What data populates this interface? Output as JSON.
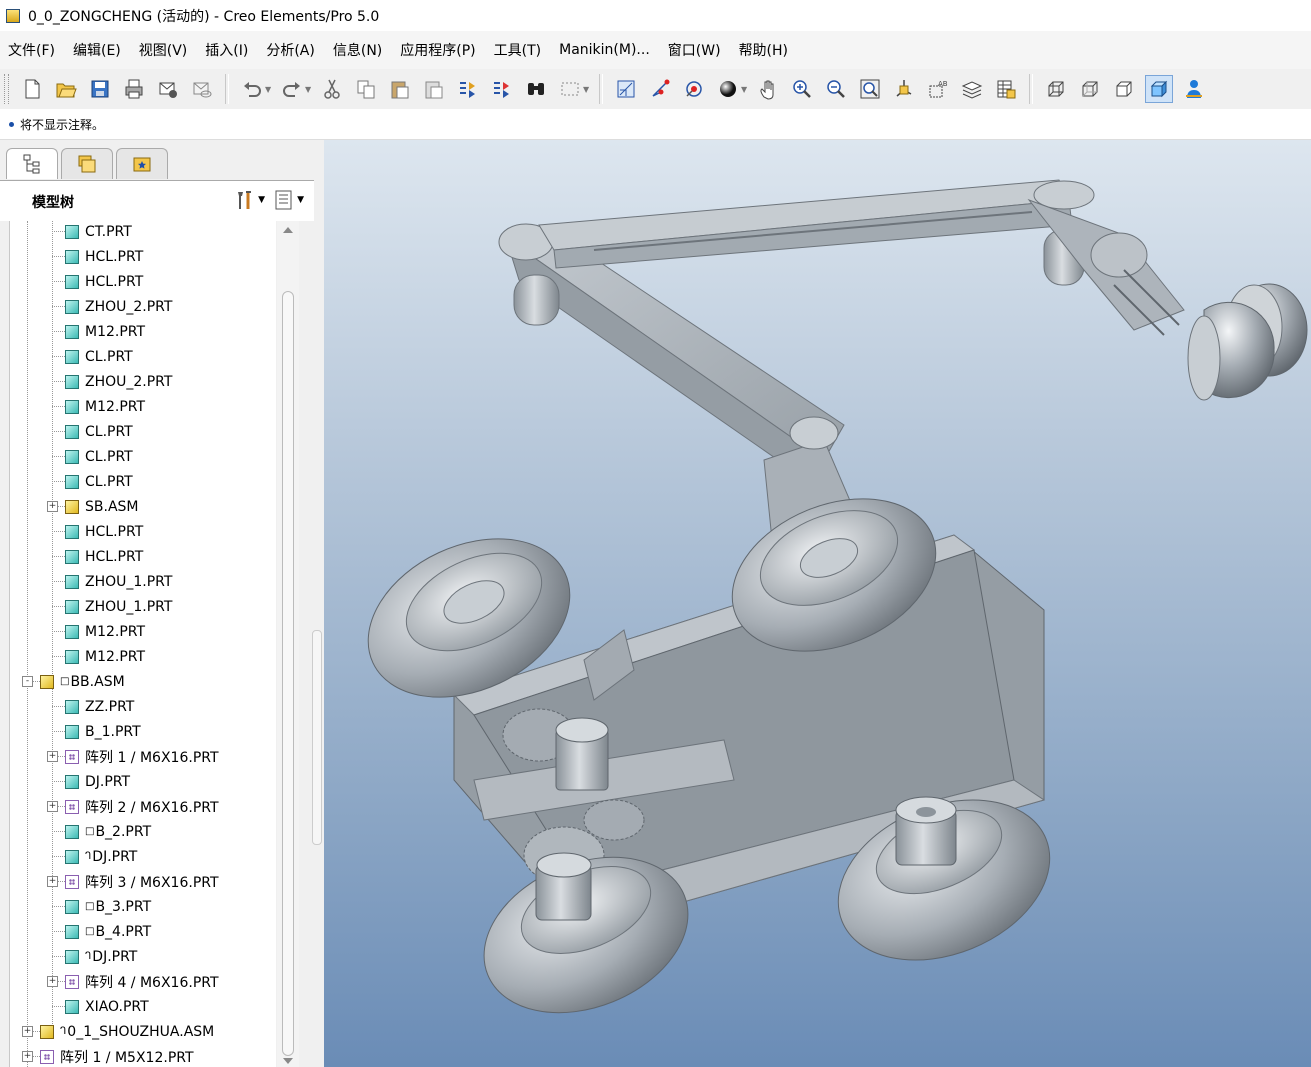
{
  "window": {
    "title": "0_0_ZONGCHENG (活动的) - Creo Elements/Pro 5.0"
  },
  "menu": [
    {
      "id": "file",
      "label": "文件(F)"
    },
    {
      "id": "edit",
      "label": "编辑(E)"
    },
    {
      "id": "view",
      "label": "视图(V)"
    },
    {
      "id": "insert",
      "label": "插入(I)"
    },
    {
      "id": "analysis",
      "label": "分析(A)"
    },
    {
      "id": "info",
      "label": "信息(N)"
    },
    {
      "id": "applications",
      "label": "应用程序(P)"
    },
    {
      "id": "tools",
      "label": "工具(T)"
    },
    {
      "id": "manikin",
      "label": "Manikin(M)..."
    },
    {
      "id": "window",
      "label": "窗口(W)"
    },
    {
      "id": "help",
      "label": "帮助(H)"
    }
  ],
  "message": {
    "text": "将不显示注释。"
  },
  "left_panel": {
    "tabs": [
      {
        "id": "model-tree",
        "icon": "model-tree-icon"
      },
      {
        "id": "folder-browser",
        "icon": "folder-browser-icon"
      },
      {
        "id": "favorites",
        "icon": "favorites-icon"
      }
    ],
    "tree_title": "模型树"
  },
  "tree_rows": [
    {
      "label": "CT.PRT",
      "icon": "prt",
      "level": 2,
      "exp": "",
      "prefix": ""
    },
    {
      "label": "HCL.PRT",
      "icon": "prt",
      "level": 2,
      "exp": "",
      "prefix": ""
    },
    {
      "label": "HCL.PRT",
      "icon": "prt",
      "level": 2,
      "exp": "",
      "prefix": ""
    },
    {
      "label": "ZHOU_2.PRT",
      "icon": "prt",
      "level": 2,
      "exp": "",
      "prefix": ""
    },
    {
      "label": "M12.PRT",
      "icon": "prt",
      "level": 2,
      "exp": "",
      "prefix": ""
    },
    {
      "label": "CL.PRT",
      "icon": "prt",
      "level": 2,
      "exp": "",
      "prefix": ""
    },
    {
      "label": "ZHOU_2.PRT",
      "icon": "prt",
      "level": 2,
      "exp": "",
      "prefix": ""
    },
    {
      "label": "M12.PRT",
      "icon": "prt",
      "level": 2,
      "exp": "",
      "prefix": ""
    },
    {
      "label": "CL.PRT",
      "icon": "prt",
      "level": 2,
      "exp": "",
      "prefix": ""
    },
    {
      "label": "CL.PRT",
      "icon": "prt",
      "level": 2,
      "exp": "",
      "prefix": ""
    },
    {
      "label": "CL.PRT",
      "icon": "prt",
      "level": 2,
      "exp": "",
      "prefix": ""
    },
    {
      "label": "SB.ASM",
      "icon": "asm",
      "level": 2,
      "exp": "+",
      "prefix": ""
    },
    {
      "label": "HCL.PRT",
      "icon": "prt",
      "level": 2,
      "exp": "",
      "prefix": ""
    },
    {
      "label": "HCL.PRT",
      "icon": "prt",
      "level": 2,
      "exp": "",
      "prefix": ""
    },
    {
      "label": "ZHOU_1.PRT",
      "icon": "prt",
      "level": 2,
      "exp": "",
      "prefix": ""
    },
    {
      "label": "ZHOU_1.PRT",
      "icon": "prt",
      "level": 2,
      "exp": "",
      "prefix": ""
    },
    {
      "label": "M12.PRT",
      "icon": "prt",
      "level": 2,
      "exp": "",
      "prefix": ""
    },
    {
      "label": "M12.PRT",
      "icon": "prt",
      "level": 2,
      "exp": "",
      "prefix": ""
    },
    {
      "label": "BB.ASM",
      "icon": "asm",
      "level": 1,
      "exp": "-",
      "prefix": "□"
    },
    {
      "label": "ZZ.PRT",
      "icon": "prt",
      "level": 2,
      "exp": "",
      "prefix": ""
    },
    {
      "label": "B_1.PRT",
      "icon": "prt",
      "level": 2,
      "exp": "",
      "prefix": ""
    },
    {
      "label": "阵列 1 / M6X16.PRT",
      "icon": "pat",
      "level": 2,
      "exp": "+",
      "prefix": ""
    },
    {
      "label": "DJ.PRT",
      "icon": "prt",
      "level": 2,
      "exp": "",
      "prefix": ""
    },
    {
      "label": "阵列 2 / M6X16.PRT",
      "icon": "pat",
      "level": 2,
      "exp": "+",
      "prefix": ""
    },
    {
      "label": "B_2.PRT",
      "icon": "prt",
      "level": 2,
      "exp": "",
      "prefix": "□"
    },
    {
      "label": "DJ.PRT",
      "icon": "prt",
      "level": 2,
      "exp": "",
      "prefix": "ᒉ"
    },
    {
      "label": "阵列 3 / M6X16.PRT",
      "icon": "pat",
      "level": 2,
      "exp": "+",
      "prefix": ""
    },
    {
      "label": "B_3.PRT",
      "icon": "prt",
      "level": 2,
      "exp": "",
      "prefix": "□"
    },
    {
      "label": "B_4.PRT",
      "icon": "prt",
      "level": 2,
      "exp": "",
      "prefix": "□"
    },
    {
      "label": "DJ.PRT",
      "icon": "prt",
      "level": 2,
      "exp": "",
      "prefix": "ᒉ"
    },
    {
      "label": "阵列 4 / M6X16.PRT",
      "icon": "pat",
      "level": 2,
      "exp": "+",
      "prefix": ""
    },
    {
      "label": "XIAO.PRT",
      "icon": "prt",
      "level": 2,
      "exp": "",
      "prefix": ""
    },
    {
      "label": "0_1_SHOUZHUA.ASM",
      "icon": "asm",
      "level": 1,
      "exp": "+",
      "prefix": "ᒉ"
    },
    {
      "label": "阵列 1 / M5X12.PRT",
      "icon": "pat",
      "level": 1,
      "exp": "+",
      "prefix": ""
    }
  ],
  "toolbar": {
    "buttons": [
      "new-icon",
      "open-icon",
      "save-icon",
      "print-icon",
      "email-icon",
      "email-link-icon",
      "undo-icon",
      "redo-icon",
      "cut-icon",
      "copy-icon",
      "paste-icon",
      "paste-special-icon",
      "regenerate-icon",
      "regen-manager-icon",
      "find-icon",
      "select-box-icon",
      "sketch-icon",
      "datum-point-icon",
      "spin-center-icon",
      "shading-icon",
      "pan-icon",
      "zoom-in-icon",
      "zoom-out-icon",
      "refit-icon",
      "reorient-icon",
      "annotation-icon",
      "layers-icon",
      "table-icon",
      "wireframe-icon",
      "hidden-line-icon",
      "no-hidden-icon",
      "shaded-icon",
      "manikin-icon"
    ]
  },
  "viewport": {
    "model_color": "#a6adb4",
    "background_top": "#dde6ef",
    "background_bottom": "#6a8cb6"
  }
}
